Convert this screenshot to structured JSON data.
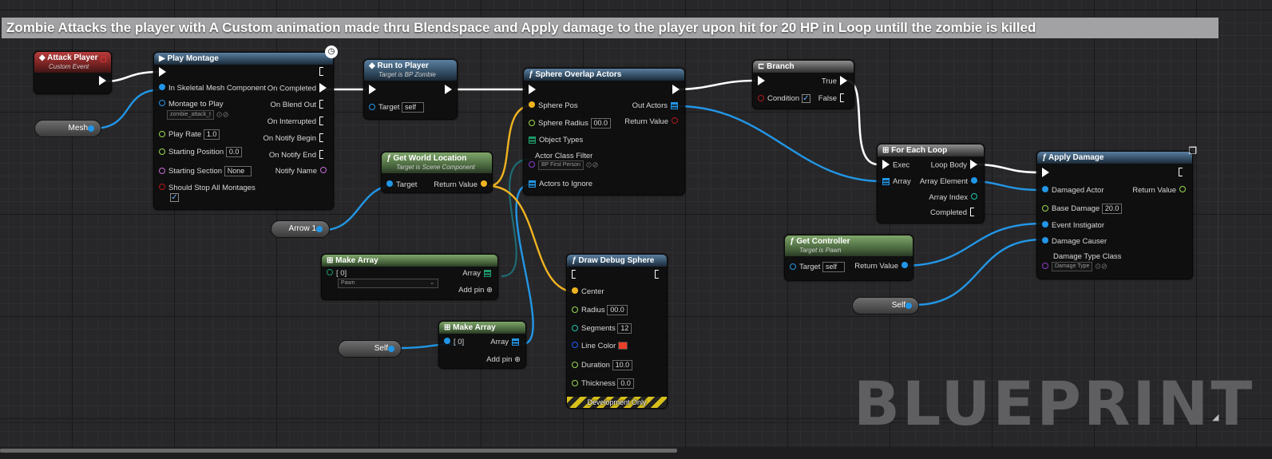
{
  "comment": "Zombie Attacks the player with A Custom animation made thru Blendspace and Apply damage to the player upon hit for 20 HP in Loop untill the zombie is killed",
  "watermark": "BLUEPRINT",
  "colors": {
    "exec": "#ffffff",
    "object": "#2296e6",
    "vector": "#f0b320",
    "float": "#9bd94d",
    "bool": "#b01818",
    "class": "#8a3cc6",
    "linear_color": "#1d5cff"
  },
  "nodes": {
    "attack_player": {
      "title": "Attack Player",
      "subtitle": "Custom Event"
    },
    "mesh": {
      "label": "Mesh"
    },
    "play_montage": {
      "title": "Play Montage",
      "in_skeletal": "In Skeletal Mesh Component",
      "montage_to_play": "Montage to Play",
      "montage_value": "zombie_attack_t",
      "play_rate": "Play Rate",
      "play_rate_value": "1.0",
      "starting_position": "Starting Position",
      "starting_position_value": "0.0",
      "starting_section": "Starting Section",
      "starting_section_value": "None",
      "should_stop": "Should Stop All Montages",
      "on_completed": "On Completed",
      "on_blend_out": "On Blend Out",
      "on_interrupted": "On Interrupted",
      "on_notify_begin": "On Notify Begin",
      "on_notify_end": "On Notify End",
      "notify_name": "Notify Name"
    },
    "run_to_player": {
      "title": "Run to Player",
      "subtitle": "Target is BP Zombie",
      "target": "Target",
      "target_value": "self"
    },
    "get_world_location": {
      "title": "Get World Location",
      "subtitle": "Target is Scene Component",
      "target": "Target",
      "return_value": "Return Value"
    },
    "arrow": {
      "label": "Arrow 1"
    },
    "make_array_1": {
      "title": "Make Array",
      "item": "[ 0]",
      "dropdown": "Pawn",
      "array": "Array",
      "add_pin": "Add pin"
    },
    "self_1": {
      "label": "Self"
    },
    "make_array_2": {
      "title": "Make Array",
      "item": "[ 0]",
      "array": "Array",
      "add_pin": "Add pin"
    },
    "sphere_overlap": {
      "title": "Sphere Overlap Actors",
      "sphere_pos": "Sphere Pos",
      "sphere_radius": "Sphere Radius",
      "sphere_radius_value": "00.0",
      "object_types": "Object Types",
      "actor_class_filter": "Actor Class Filter",
      "actor_class_value": "BP First Person",
      "actors_to_ignore": "Actors to Ignore",
      "out_actors": "Out Actors",
      "return_value": "Return Value"
    },
    "draw_debug_sphere": {
      "title": "Draw Debug Sphere",
      "center": "Center",
      "radius": "Radius",
      "radius_value": "00.0",
      "segments": "Segments",
      "segments_value": "12",
      "line_color": "Line Color",
      "duration": "Duration",
      "duration_value": "10.0",
      "thickness": "Thickness",
      "thickness_value": "0.0",
      "dev_only": "Development Only"
    },
    "branch": {
      "title": "Branch",
      "condition": "Condition",
      "true_label": "True",
      "false_label": "False"
    },
    "for_each": {
      "title": "For Each Loop",
      "exec": "Exec",
      "array": "Array",
      "loop_body": "Loop Body",
      "array_element": "Array Element",
      "array_index": "Array Index",
      "completed": "Completed"
    },
    "get_controller": {
      "title": "Get Controller",
      "subtitle": "Target is Pawn",
      "target": "Target",
      "target_value": "self",
      "return_value": "Return Value"
    },
    "self_2": {
      "label": "Self"
    },
    "apply_damage": {
      "title": "Apply Damage",
      "damaged_actor": "Damaged Actor",
      "base_damage": "Base Damage",
      "base_damage_value": "20.0",
      "event_instigator": "Event Instigator",
      "damage_causer": "Damage Causer",
      "damage_type_class": "Damage Type Class",
      "damage_type_value": "Damage Type",
      "return_value": "Return Value"
    }
  }
}
